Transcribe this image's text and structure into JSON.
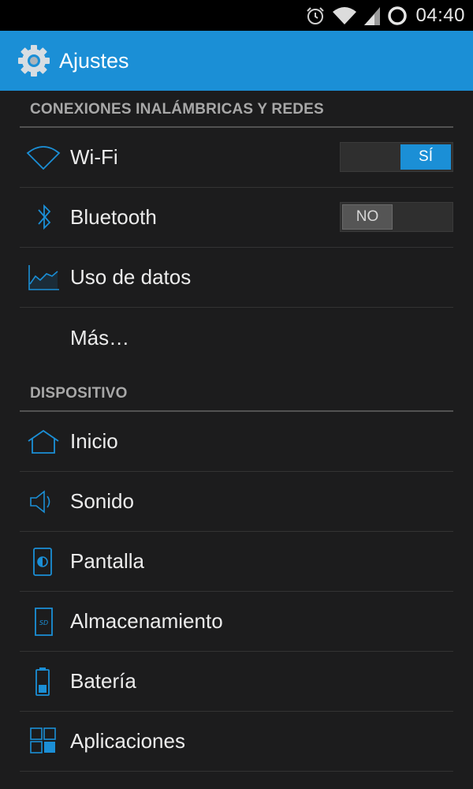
{
  "status_bar": {
    "time": "04:40",
    "icons": [
      "alarm-icon",
      "wifi-signal-icon",
      "cell-signal-icon",
      "sync-circle-icon"
    ]
  },
  "action_bar": {
    "title": "Ajustes",
    "icon": "gear-icon"
  },
  "sections": [
    {
      "header": "CONEXIONES INALÁMBRICAS Y REDES",
      "items": [
        {
          "label": "Wi-Fi",
          "icon": "wifi-icon",
          "toggle": {
            "state": "on",
            "text": "SÍ"
          }
        },
        {
          "label": "Bluetooth",
          "icon": "bluetooth-icon",
          "toggle": {
            "state": "off",
            "text": "NO"
          }
        },
        {
          "label": "Uso de datos",
          "icon": "data-usage-icon"
        },
        {
          "label": "Más…",
          "icon": ""
        }
      ]
    },
    {
      "header": "DISPOSITIVO",
      "items": [
        {
          "label": "Inicio",
          "icon": "home-icon"
        },
        {
          "label": "Sonido",
          "icon": "sound-icon"
        },
        {
          "label": "Pantalla",
          "icon": "display-icon"
        },
        {
          "label": "Almacenamiento",
          "icon": "sd-card-icon"
        },
        {
          "label": "Batería",
          "icon": "battery-icon"
        },
        {
          "label": "Aplicaciones",
          "icon": "apps-icon"
        }
      ]
    }
  ],
  "colors": {
    "accent": "#1b8fd6",
    "background": "#1c1c1d",
    "status_bar": "#000000",
    "header_text": "#a8a8a8"
  }
}
